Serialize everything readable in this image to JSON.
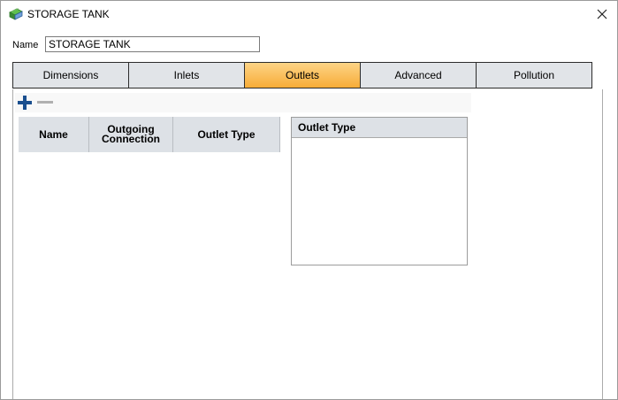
{
  "window": {
    "title": "STORAGE TANK",
    "icon": "storage-tank-icon",
    "close_icon": "close-icon"
  },
  "name_field": {
    "label": "Name",
    "value": "STORAGE TANK"
  },
  "tabs": [
    {
      "label": "Dimensions",
      "active": false
    },
    {
      "label": "Inlets",
      "active": false
    },
    {
      "label": "Outlets",
      "active": true
    },
    {
      "label": "Advanced",
      "active": false
    },
    {
      "label": "Pollution",
      "active": false
    }
  ],
  "toolbar": {
    "add_icon": "plus-icon",
    "remove_icon": "minus-icon",
    "add_color": "#1a4f8f",
    "remove_color": "#b0b0b0"
  },
  "outlets_grid": {
    "columns": [
      "Name",
      "Outgoing Connection",
      "Outlet Type"
    ],
    "rows": []
  },
  "outlet_type_panel": {
    "header": "Outlet Type",
    "items": []
  },
  "colors": {
    "active_tab_top": "#fdd486",
    "active_tab_bottom": "#f7ac37",
    "tab_bg": "#e1e4e8",
    "header_bg": "#dde1e6"
  }
}
